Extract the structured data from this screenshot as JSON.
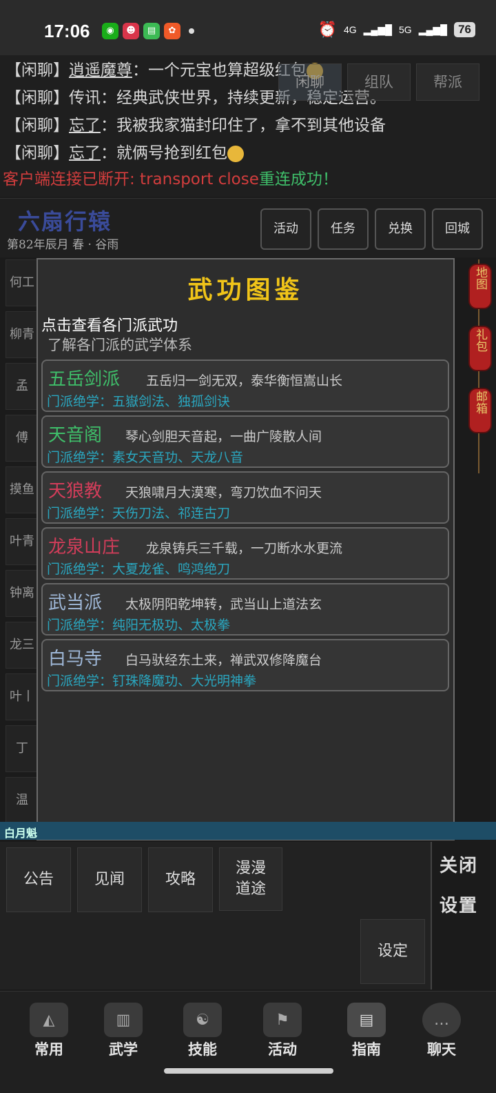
{
  "status_bar": {
    "time": "17:06",
    "net1": "4G",
    "net2": "5G",
    "battery": "76"
  },
  "chat": {
    "lines": [
      {
        "tag": "【闲聊】",
        "name": "逍遥魔尊",
        "text": "：一个元宝也算超级红包"
      },
      {
        "tag": "【闲聊】",
        "name": "传讯",
        "text": "：经典武侠世界，持续更新，稳定运营。"
      },
      {
        "tag": "【闲聊】",
        "name": "忘了",
        "text": "：我被我家猫封印住了，拿不到其他设备"
      },
      {
        "tag": "【闲聊】",
        "name": "忘了",
        "text": "：就俩号抢到红包"
      }
    ],
    "system_red": "客户端连接已断开: transport close",
    "system_green": "重连成功！",
    "tabs": [
      "闲聊",
      "组队",
      "帮派"
    ]
  },
  "header": {
    "region": "六扇行辕",
    "date": "第82年辰月 春 · 谷雨",
    "buttons": [
      "活动",
      "任务",
      "兑换",
      "回城"
    ]
  },
  "left_list": [
    "何工",
    "柳青",
    "孟",
    "傅",
    "摸鱼",
    "叶青",
    "钟离",
    "龙三",
    "叶丨",
    "丁",
    "温"
  ],
  "lanterns": [
    "地图",
    "礼包",
    "邮箱"
  ],
  "modal": {
    "title": "武功图鉴",
    "subtitle": "点击查看各门派武功",
    "subtitle2": "了解各门派的武学体系",
    "sects": [
      {
        "name": "五岳剑派",
        "desc": "五岳归一剑无双，泰华衡恒嵩山长",
        "skills": "门派绝学：五嶽剑法、独孤剑诀",
        "color": "#3fbf6a"
      },
      {
        "name": "天音阁",
        "desc": "琴心剑胆天音起，一曲广陵散人间",
        "skills": "门派绝学：素女天音功、天龙八音",
        "color": "#3fbf6a"
      },
      {
        "name": "天狼教",
        "desc": "天狼啸月大漠寒，弯刀饮血不问天",
        "skills": "门派绝学：天伤刀法、祁连古刀",
        "color": "#d23d5a"
      },
      {
        "name": "龙泉山庄",
        "desc": "龙泉铸兵三千载，一刀断水水更流",
        "skills": "门派绝学：大夏龙雀、鸣鸿绝刀",
        "color": "#d23d5a"
      },
      {
        "name": "武当派",
        "desc": "太极阴阳乾坤转，武当山上道法玄",
        "skills": "门派绝学：纯阳无极功、太极拳",
        "color": "#9fb8d8"
      },
      {
        "name": "白马寺",
        "desc": "白马驮经东土来，禅武双修降魔台",
        "skills": "门派绝学：钉珠降魔功、大光明神拳",
        "color": "#9fb8d8"
      }
    ]
  },
  "strip_text": "白月魁",
  "bottom_panel": {
    "buttons": [
      "公告",
      "见闻",
      "攻略",
      "漫漫道途"
    ],
    "settings_button": "设定",
    "close": "关闭",
    "settings": "设置"
  },
  "nav": [
    {
      "label": "常用",
      "icon": "straw-hat-icon"
    },
    {
      "label": "武学",
      "icon": "scroll-icon"
    },
    {
      "label": "技能",
      "icon": "martial-artist-icon"
    },
    {
      "label": "活动",
      "icon": "banner-icon"
    },
    {
      "label": "指南",
      "icon": "book-icon"
    },
    {
      "label": "聊天",
      "icon": "speech-bubble-icon"
    }
  ]
}
